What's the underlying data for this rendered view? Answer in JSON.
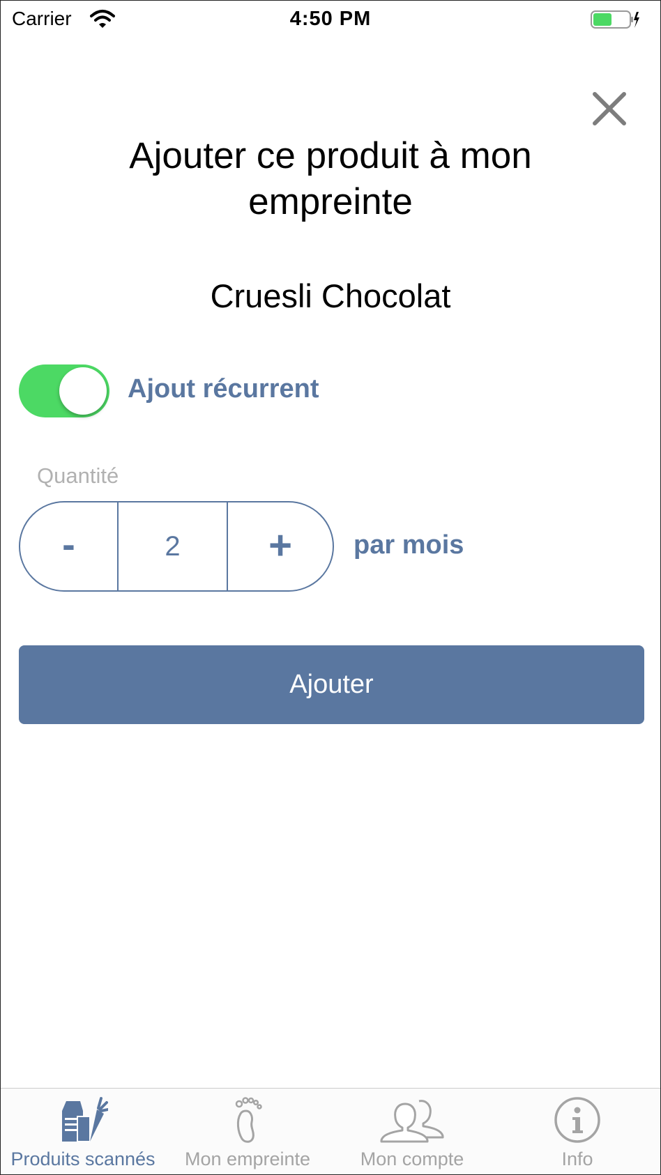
{
  "status_bar": {
    "carrier": "Carrier",
    "time": "4:50 PM",
    "battery_color": "#4cd964"
  },
  "modal": {
    "title": "Ajouter ce produit à mon empreinte",
    "product_name": "Cruesli Chocolat",
    "close_icon": "close-icon"
  },
  "recurring": {
    "label": "Ajout récurrent",
    "enabled": true,
    "on_color": "#4cd964"
  },
  "quantity": {
    "label": "Quantité",
    "decrement_label": "-",
    "value": "2",
    "increment_label": "+",
    "unit_label": "par mois"
  },
  "add_button": {
    "label": "Ajouter",
    "color": "#5a77a0"
  },
  "tab_bar": {
    "active_color": "#5a77a0",
    "inactive_color": "#a4a4a4",
    "tabs": [
      {
        "label": "Produits scannés",
        "icon": "grocery-bag-icon",
        "active": true
      },
      {
        "label": "Mon empreinte",
        "icon": "footprint-icon",
        "active": false
      },
      {
        "label": "Mon compte",
        "icon": "users-icon",
        "active": false
      },
      {
        "label": "Info",
        "icon": "info-icon",
        "active": false
      }
    ]
  }
}
